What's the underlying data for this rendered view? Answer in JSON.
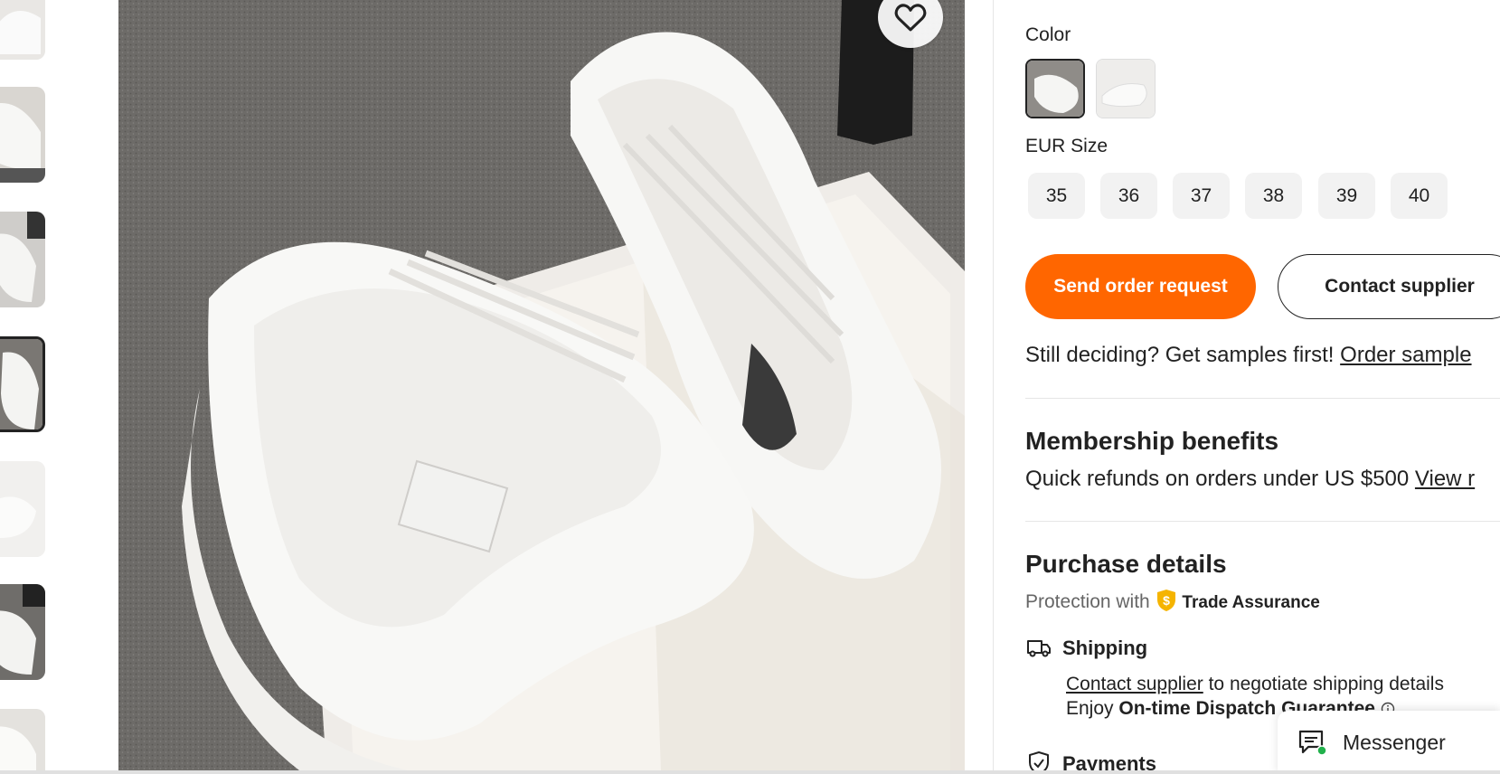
{
  "favorite": {
    "icon": "heart-icon"
  },
  "product_options": {
    "color_label": "Color",
    "colors": [
      {
        "name": "white-sneaker-photo-1",
        "selected": true
      },
      {
        "name": "white-sneaker-photo-2",
        "selected": false
      }
    ],
    "size_label": "EUR Size",
    "sizes": [
      "35",
      "36",
      "37",
      "38",
      "39",
      "40"
    ]
  },
  "actions": {
    "send_order_request": "Send order request",
    "contact_supplier": "Contact supplier"
  },
  "samples": {
    "text": "Still deciding? Get samples first!",
    "link": "Order sample"
  },
  "membership": {
    "title": "Membership benefits",
    "text": "Quick refunds on orders under US $500",
    "link": "View r"
  },
  "purchase": {
    "title": "Purchase details",
    "protection_prefix": "Protection with",
    "trade_assurance": "Trade Assurance",
    "shipping": {
      "title": "Shipping",
      "contact_link": "Contact supplier",
      "negotiate_text": "to negotiate shipping details",
      "enjoy": "Enjoy",
      "guarantee": "On-time Dispatch Guarantee"
    },
    "payments": {
      "title": "Payments"
    }
  },
  "messenger": {
    "label": "Messenger",
    "online_color": "#22b14c"
  },
  "colors": {
    "accent": "#ff6600",
    "trade_assurance_gold": "#f5b400"
  }
}
